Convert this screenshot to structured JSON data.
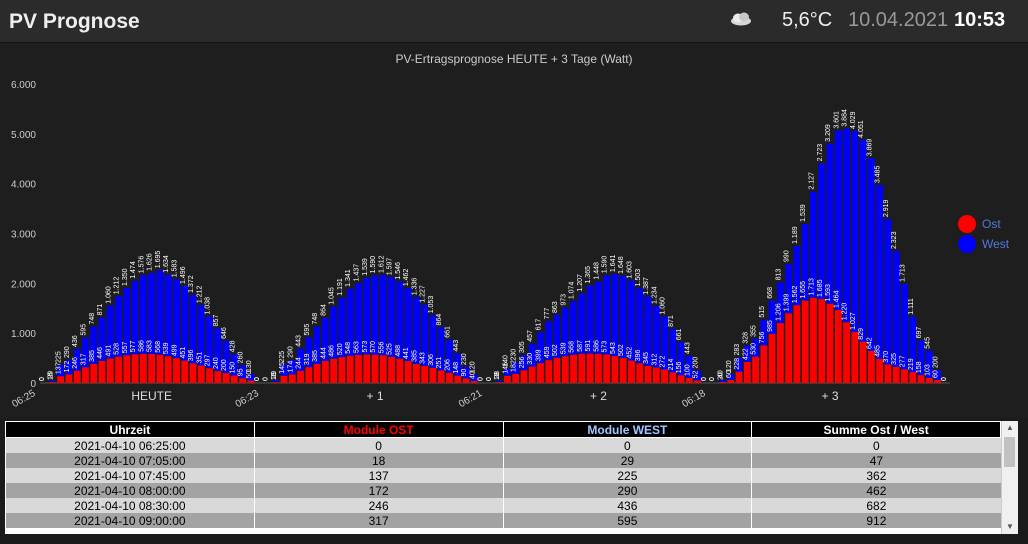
{
  "header": {
    "title": "PV Prognose",
    "weather_icon": "cloud-icon",
    "temperature": "5,6°C",
    "date": "10.04.2021",
    "time": "10:53"
  },
  "chart_data": {
    "type": "bar",
    "stacked": true,
    "title": "PV-Ertragsprognose HEUTE + 3 Tage (Watt)",
    "ylim": [
      0,
      6000
    ],
    "yticks": [
      "0",
      "1.000",
      "2.000",
      "3.000",
      "4.000",
      "5.000",
      "6.000"
    ],
    "day_labels": [
      "HEUTE",
      "+ 1",
      "+ 2",
      "+ 3"
    ],
    "start_time_labels": [
      "06:25",
      "06:23",
      "06:21",
      "06:18"
    ],
    "colors": {
      "ost": "#ff0000",
      "west": "#0000ff"
    },
    "series": [
      {
        "name": "Ost",
        "days": [
          [
            0,
            18,
            137,
            172,
            246,
            317,
            385,
            446,
            491,
            528,
            557,
            577,
            586,
            583,
            568,
            539,
            499,
            451,
            396,
            351,
            297,
            240,
            200,
            150,
            95,
            50,
            0
          ],
          [
            0,
            18,
            145,
            174,
            244,
            319,
            385,
            444,
            486,
            520,
            548,
            563,
            573,
            570,
            556,
            525,
            488,
            441,
            385,
            343,
            306,
            251,
            206,
            148,
            90,
            40,
            0
          ],
          [
            0,
            18,
            146,
            182,
            256,
            330,
            399,
            459,
            502,
            539,
            568,
            587,
            591,
            586,
            573,
            543,
            502,
            452,
            396,
            345,
            312,
            272,
            214,
            156,
            100,
            52,
            0
          ],
          [
            0,
            20,
            60,
            228,
            422,
            530,
            756,
            985,
            1206,
            1399,
            1562,
            1655,
            1713,
            1685,
            1593,
            1464,
            1220,
            1027,
            829,
            642,
            485,
            370,
            325,
            277,
            219,
            158,
            103,
            60,
            0
          ]
        ]
      },
      {
        "name": "West",
        "days": [
          [
            0,
            29,
            225,
            290,
            436,
            595,
            748,
            871,
            1060,
            1212,
            1350,
            1474,
            1576,
            1626,
            1695,
            1634,
            1583,
            1496,
            1372,
            1212,
            1038,
            857,
            646,
            428,
            260,
            130,
            0
          ],
          [
            0,
            29,
            225,
            290,
            443,
            595,
            748,
            864,
            1045,
            1191,
            1341,
            1437,
            1539,
            1590,
            1612,
            1597,
            1546,
            1462,
            1336,
            1227,
            1053,
            864,
            661,
            443,
            230,
            120,
            0
          ],
          [
            0,
            28,
            140,
            230,
            305,
            457,
            617,
            777,
            863,
            973,
            1074,
            1207,
            1365,
            1448,
            1590,
            1641,
            1648,
            1603,
            1503,
            1387,
            1234,
            1060,
            871,
            661,
            443,
            200,
            0
          ],
          [
            0,
            40,
            120,
            283,
            328,
            355,
            515,
            668,
            813,
            990,
            1189,
            1539,
            2127,
            2723,
            3209,
            3601,
            3884,
            4029,
            4051,
            3869,
            3485,
            2919,
            2323,
            1713,
            1111,
            697,
            545,
            200,
            0
          ]
        ]
      }
    ]
  },
  "legend": {
    "items": [
      {
        "label": "Ost",
        "color": "#ff0000"
      },
      {
        "label": "West",
        "color": "#0000ff"
      }
    ]
  },
  "table": {
    "headers": [
      "Uhrzeit",
      "Module OST",
      "Module WEST",
      "Summe Ost / West"
    ],
    "header_colors": [
      "#ffffff",
      "#ff0000",
      "#a0c8ff",
      "#ffffff"
    ],
    "rows": [
      [
        "2021-04-10 06:25:00",
        "0",
        "0",
        "0"
      ],
      [
        "2021-04-10 07:05:00",
        "18",
        "29",
        "47"
      ],
      [
        "2021-04-10 07:45:00",
        "137",
        "225",
        "362"
      ],
      [
        "2021-04-10 08:00:00",
        "172",
        "290",
        "462"
      ],
      [
        "2021-04-10 08:30:00",
        "246",
        "436",
        "682"
      ],
      [
        "2021-04-10 09:00:00",
        "317",
        "595",
        "912"
      ]
    ]
  }
}
